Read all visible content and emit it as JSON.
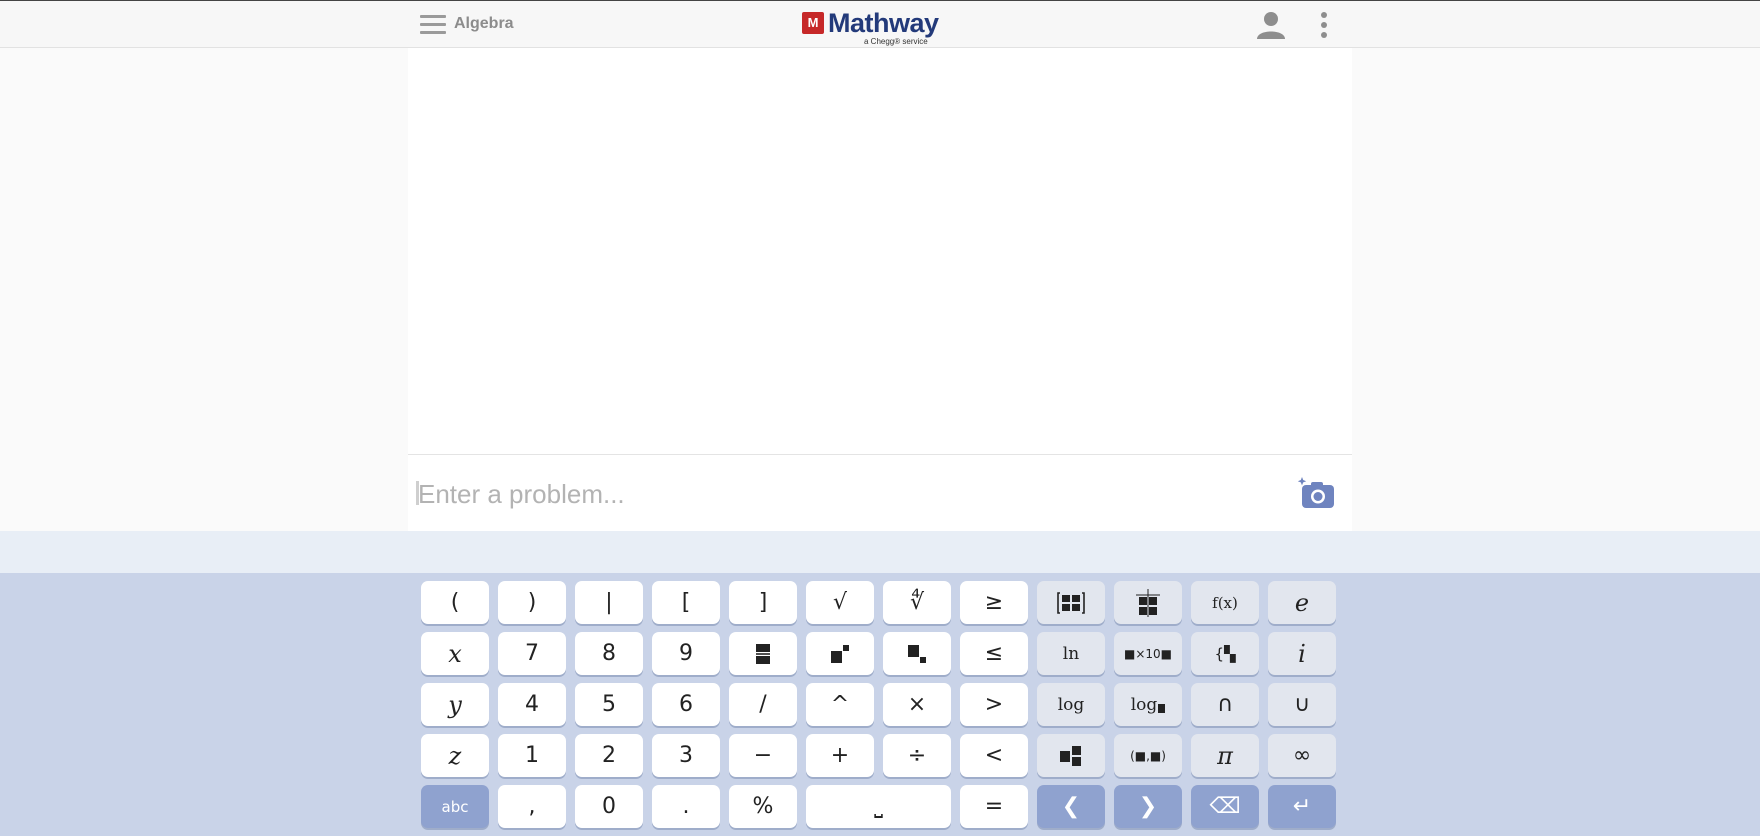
{
  "header": {
    "subject": "Algebra",
    "logo_mark": "M",
    "logo_text": "Mathway",
    "logo_sub": "a Chegg® service",
    "icons": {
      "menu": "hamburger-icon",
      "user": "user-icon",
      "more": "more-vertical-icon"
    }
  },
  "input": {
    "placeholder": "Enter a problem...",
    "value": "",
    "camera_icon": "camera-icon"
  },
  "keyboard": {
    "rows": [
      [
        "(",
        ")",
        "|",
        "[",
        "]",
        "√",
        "∛",
        "≥",
        "[■■]",
        "matrix",
        "f(x)",
        "e"
      ],
      [
        "x",
        "7",
        "8",
        "9",
        "fraction",
        "superscript",
        "subscript",
        "≤",
        "ln",
        "■×10■",
        "{■",
        "i"
      ],
      [
        "y",
        "4",
        "5",
        "6",
        "/",
        "^",
        "×",
        ">",
        "log",
        "log■",
        "∩",
        "∪"
      ],
      [
        "z",
        "1",
        "2",
        "3",
        "−",
        "+",
        "÷",
        "<",
        "mixed",
        "(■,■)",
        "π",
        "∞"
      ],
      [
        "abc",
        ",",
        "0",
        ".",
        "%",
        "space",
        "=",
        "left",
        "right",
        "backspace",
        "enter"
      ]
    ],
    "labels": {
      "lparen": "(",
      "rparen": ")",
      "abs": "|",
      "lbrack": "[",
      "rbrack": "]",
      "sqrt": "√",
      "cbrt": "∜",
      "ge": "≥",
      "fx": "f(x)",
      "e": "e",
      "x": "x",
      "seven": "7",
      "eight": "8",
      "nine": "9",
      "le": "≤",
      "ln": "ln",
      "sci": "■×10■",
      "piece": "{▚",
      "i": "i",
      "y": "y",
      "four": "4",
      "five": "5",
      "six": "6",
      "slash": "/",
      "caret": "^",
      "times": "×",
      "gt": ">",
      "log": "log",
      "logb": "log",
      "cap": "∩",
      "cup": "∪",
      "z": "z",
      "one": "1",
      "two": "2",
      "three": "3",
      "minus": "−",
      "plus": "+",
      "divide": "÷",
      "lt": "<",
      "pair": "(■,■)",
      "pi": "π",
      "inf": "∞",
      "abc": "abc",
      "comma": ",",
      "zero": "0",
      "dot": ".",
      "percent": "%",
      "space": "⎵",
      "equals": "=",
      "left": "❮",
      "right": "❯",
      "backspace": "⌫",
      "enter": "↵"
    }
  }
}
